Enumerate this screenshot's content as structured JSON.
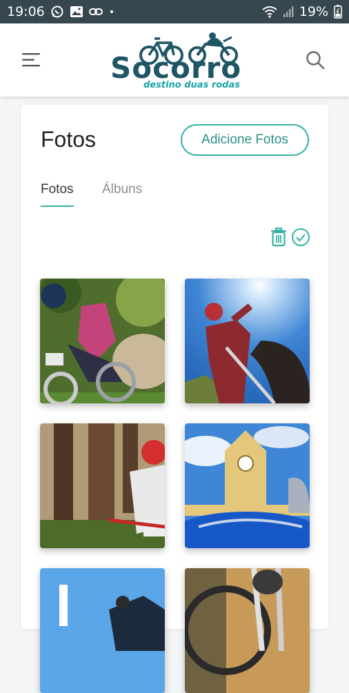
{
  "status_bar": {
    "time": "19:06",
    "battery": "19%",
    "icons": [
      "whatsapp-icon",
      "gallery-icon",
      "link-icon",
      "dot-icon",
      "wifi-icon",
      "signal-icon",
      "battery-icon"
    ]
  },
  "header": {
    "logo_text": "Socorro",
    "logo_tagline": "destino duas rodas",
    "menu_icon": "menu-icon",
    "search_icon": "search-icon"
  },
  "page": {
    "title": "Fotos",
    "add_button": "Adicione Fotos",
    "tabs": [
      {
        "label": "Fotos",
        "active": true
      },
      {
        "label": "Álbuns",
        "active": false
      }
    ],
    "tools": [
      "trash-icon",
      "check-circle-icon"
    ]
  },
  "photos": [
    {
      "subject": "mountain bike rider in pink jersey"
    },
    {
      "subject": "rider on bike against blue sky"
    },
    {
      "subject": "rider in forest with red helmet"
    },
    {
      "subject": "clock tower and blue motorcycle"
    },
    {
      "subject": "rider against sky"
    },
    {
      "subject": "bicycle wheel close-up"
    }
  ],
  "colors": {
    "status_bar": "#37474f",
    "accent": "#34b2a6",
    "logo": "#1f5665",
    "background": "#f3f5f6"
  }
}
